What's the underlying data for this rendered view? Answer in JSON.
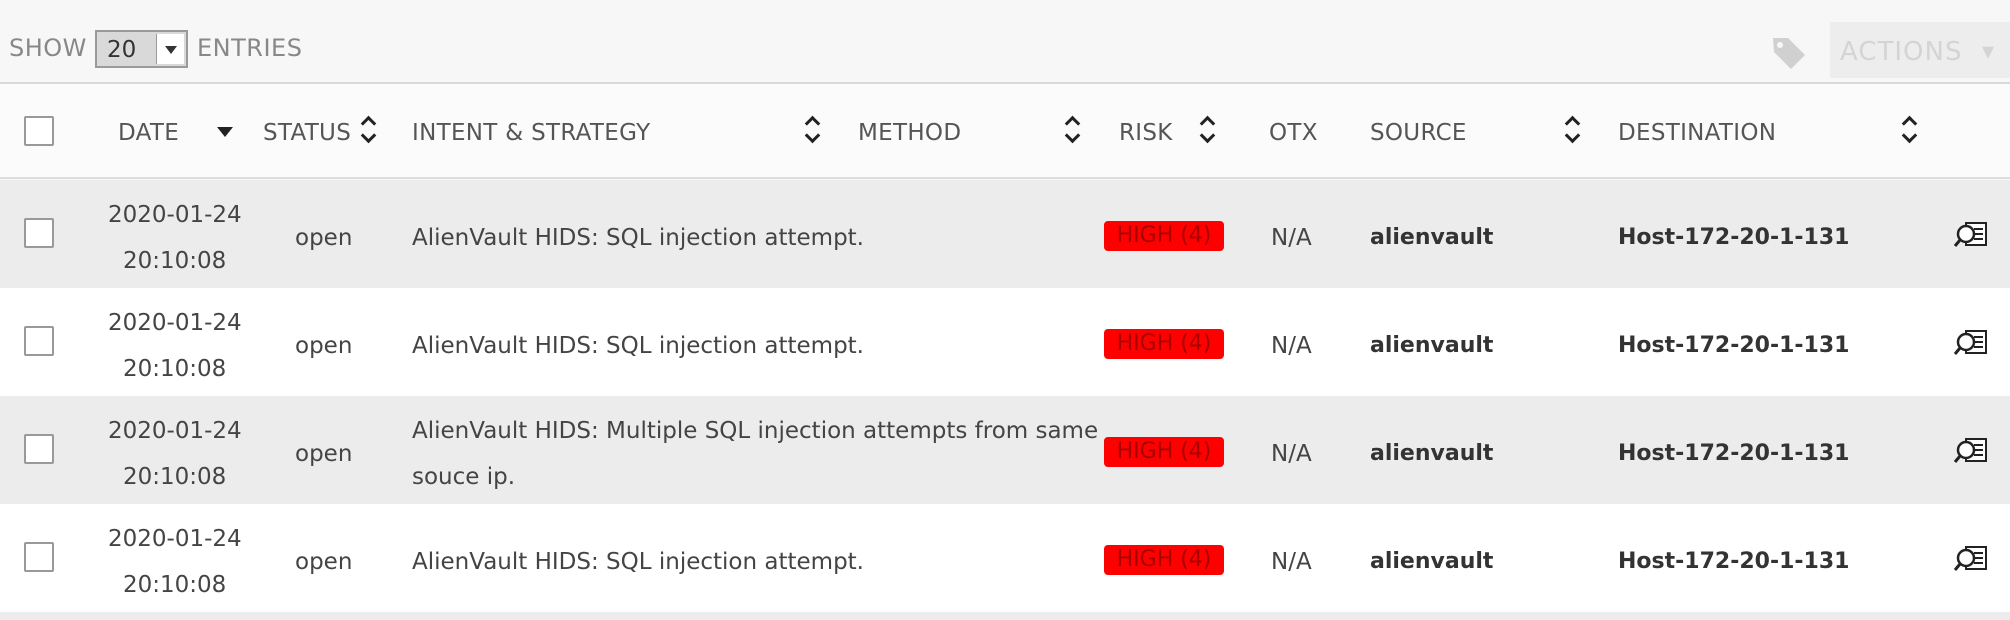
{
  "toolbar": {
    "show_label": "SHOW",
    "entries_value": "20",
    "entries_label": "ENTRIES",
    "actions_label": "ACTIONS",
    "actions_caret": "▾"
  },
  "columns": {
    "date": "DATE",
    "status": "STATUS",
    "intent": "INTENT & STRATEGY",
    "method": "METHOD",
    "risk": "RISK",
    "otx": "OTX",
    "source": "SOURCE",
    "destination": "DESTINATION"
  },
  "rows": [
    {
      "date": "2020-01-24",
      "time": "20:10:08",
      "status": "open",
      "intent_line1": "AlienVault HIDS: SQL injection attempt.",
      "intent_line2": "",
      "risk": "HIGH (4)",
      "otx": "N/A",
      "source": "alienvault",
      "destination": "Host-172-20-1-131"
    },
    {
      "date": "2020-01-24",
      "time": "20:10:08",
      "status": "open",
      "intent_line1": "AlienVault HIDS: SQL injection attempt.",
      "intent_line2": "",
      "risk": "HIGH (4)",
      "otx": "N/A",
      "source": "alienvault",
      "destination": "Host-172-20-1-131"
    },
    {
      "date": "2020-01-24",
      "time": "20:10:08",
      "status": "open",
      "intent_line1": "AlienVault HIDS: Multiple SQL injection attempts from same",
      "intent_line2": "souce ip.",
      "risk": "HIGH (4)",
      "otx": "N/A",
      "source": "alienvault",
      "destination": "Host-172-20-1-131"
    },
    {
      "date": "2020-01-24",
      "time": "20:10:08",
      "status": "open",
      "intent_line1": "AlienVault HIDS: SQL injection attempt.",
      "intent_line2": "",
      "risk": "HIGH (4)",
      "otx": "N/A",
      "source": "alienvault",
      "destination": "Host-172-20-1-131"
    }
  ],
  "colors": {
    "risk_high_bg": "#ff0000",
    "row_alt": "#ececec"
  },
  "icons": {
    "tag": "tag-icon",
    "detail": "search-detail-icon"
  }
}
